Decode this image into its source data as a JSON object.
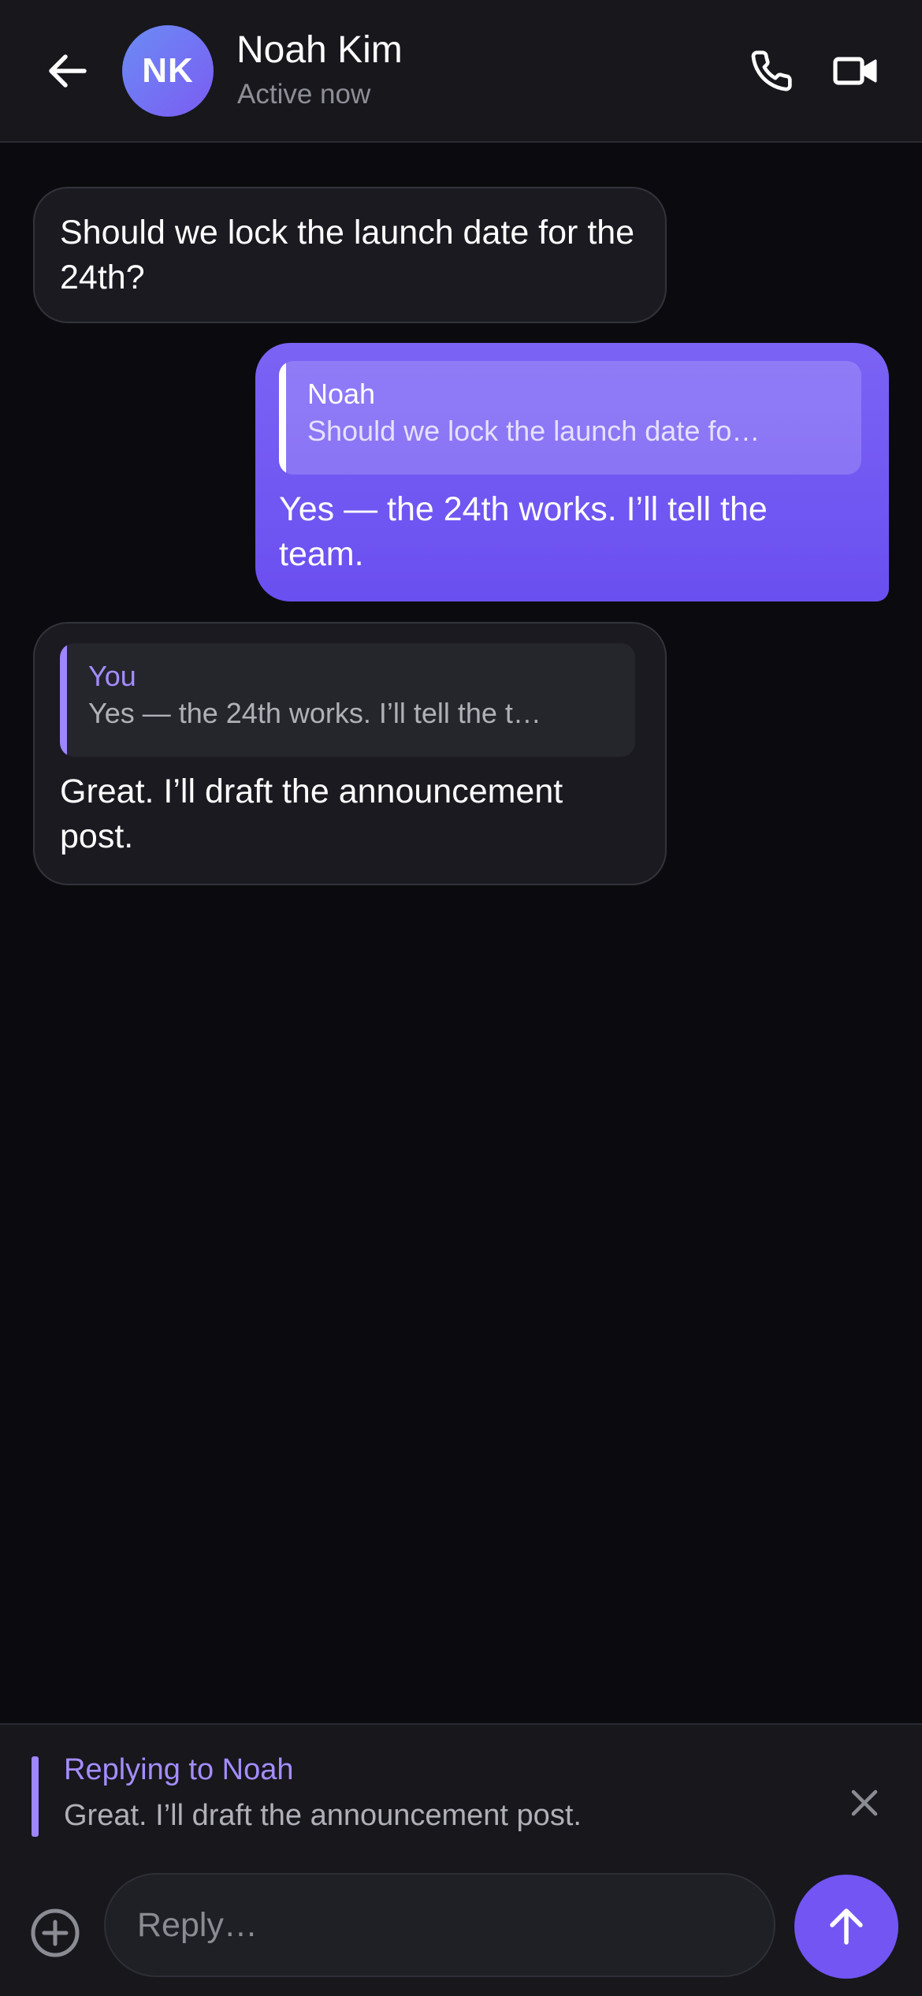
{
  "header": {
    "avatar_initials": "NK",
    "contact_name": "Noah Kim",
    "status": "Active now",
    "icons": {
      "back": "arrow-left-icon",
      "call": "phone-icon",
      "video": "video-camera-icon"
    }
  },
  "messages": [
    {
      "direction": "incoming",
      "text": "Should we lock the launch date for the 24th?"
    },
    {
      "direction": "outgoing",
      "quote": {
        "author": "Noah",
        "text": "Should we lock the launch date fo…"
      },
      "text": "Yes — the 24th works. I’ll tell the team."
    },
    {
      "direction": "incoming",
      "quote": {
        "author": "You",
        "text": "Yes — the 24th works. I’ll tell the t…"
      },
      "text": "Great. I’ll draft the announcement post."
    }
  ],
  "composer": {
    "reply_title": "Replying to Noah",
    "reply_text": "Great. I’ll draft the announcement post.",
    "placeholder": "Reply…",
    "value": "",
    "icons": {
      "close": "close-icon",
      "attach": "plus-circle-icon",
      "send": "arrow-up-icon"
    }
  },
  "colors": {
    "background": "#0b0b0f",
    "header": "#17171c",
    "incoming_bubble": "#1a1a20",
    "outgoing_bubble": "#6a4ff0",
    "accent": "#7355f4",
    "accent_light": "#a48dff",
    "muted_text": "#8e8e98"
  }
}
